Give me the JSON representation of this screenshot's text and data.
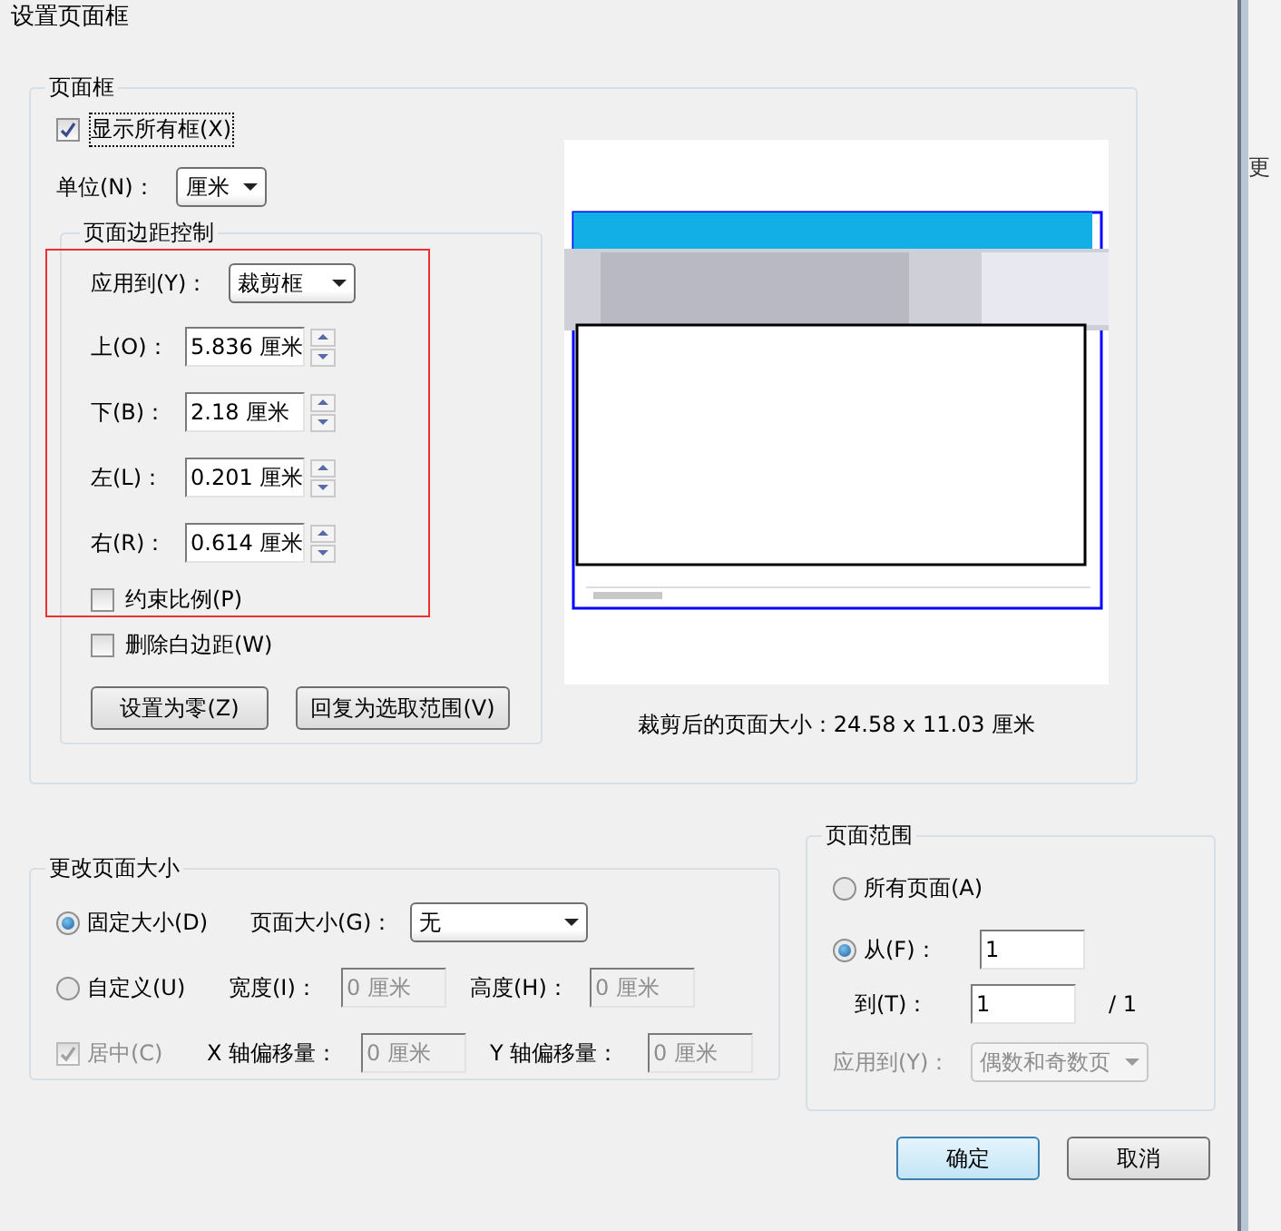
{
  "window": {
    "title": "设置页面框"
  },
  "page_box": {
    "title": "页面框",
    "show_all": {
      "label": "显示所有框(X)",
      "checked": true
    },
    "unit": {
      "label": "单位(N)：",
      "value": "厘米"
    },
    "margins": {
      "title": "页面边距控制",
      "apply_to": {
        "label": "应用到(Y)：",
        "value": "裁剪框"
      },
      "fields": [
        {
          "label": "上(O)：",
          "value": "5.836 厘米"
        },
        {
          "label": "下(B)：",
          "value": "2.18 厘米"
        },
        {
          "label": "左(L)：",
          "value": "0.201 厘米"
        },
        {
          "label": "右(R)：",
          "value": "0.614 厘米"
        }
      ],
      "checkboxes": [
        {
          "label": "约束比例(P)",
          "checked": false
        },
        {
          "label": "删除白边距(W)",
          "checked": false
        }
      ],
      "buttons": [
        "设置为零(Z)",
        "回复为选取范围(V)"
      ]
    },
    "preview_caption": "裁剪后的页面大小：24.58 x 11.03 厘米"
  },
  "change_size": {
    "title": "更改页面大小",
    "fixed": {
      "label": "固定大小(D)",
      "selected": true
    },
    "page_size": {
      "label": "页面大小(G)：",
      "value": "无"
    },
    "custom": {
      "label": "自定义(U)",
      "selected": false
    },
    "width": {
      "label": "宽度(I)：",
      "value": "0 厘米",
      "disabled": true
    },
    "height": {
      "label": "高度(H)：",
      "value": "0 厘米",
      "disabled": true
    },
    "center": {
      "label": "居中(C)",
      "checked": true,
      "disabled": true
    },
    "x_offset": {
      "label": "X 轴偏移量：",
      "value": "0 厘米",
      "disabled": true
    },
    "y_offset": {
      "label": "Y 轴偏移量：",
      "value": "0 厘米",
      "disabled": true
    }
  },
  "page_range": {
    "title": "页面范围",
    "all": {
      "label": "所有页面(A)",
      "selected": false
    },
    "from": {
      "label": "从(F)：",
      "value": "1",
      "selected": true
    },
    "to": {
      "label": "到(T)：",
      "value": "1"
    },
    "total": "/ 1",
    "apply_to": {
      "label": "应用到(Y)：",
      "value": "偶数和奇数页",
      "disabled": true
    }
  },
  "buttons": [
    {
      "label": "确定",
      "default": true
    },
    {
      "label": "取消",
      "default": false
    }
  ],
  "background_text": "更"
}
